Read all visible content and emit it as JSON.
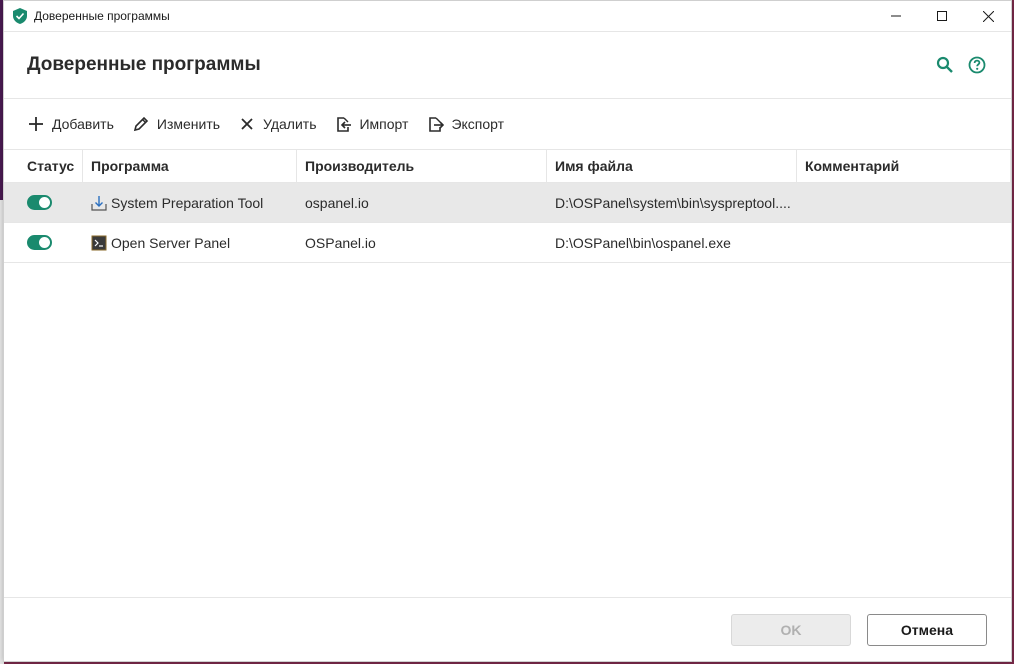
{
  "window": {
    "title": "Доверенные программы"
  },
  "header": {
    "title": "Доверенные программы",
    "icons": [
      "search-icon",
      "help-icon"
    ]
  },
  "toolbar": {
    "add_label": "Добавить",
    "edit_label": "Изменить",
    "delete_label": "Удалить",
    "import_label": "Импорт",
    "export_label": "Экспорт"
  },
  "table": {
    "columns": {
      "status": "Статус",
      "program": "Программа",
      "vendor": "Производитель",
      "file": "Имя файла",
      "comment": "Комментарий"
    },
    "rows": [
      {
        "status_on": true,
        "icon": "download-installer-icon",
        "program": "System Preparation Tool",
        "vendor": "ospanel.io",
        "file": "D:\\OSPanel\\system\\bin\\syspreptool....",
        "comment": ""
      },
      {
        "status_on": true,
        "icon": "terminal-icon",
        "program": "Open Server Panel",
        "vendor": "OSPanel.io",
        "file": "D:\\OSPanel\\bin\\ospanel.exe",
        "comment": ""
      }
    ]
  },
  "footer": {
    "ok_label": "OK",
    "cancel_label": "Отмена"
  },
  "colors": {
    "accent": "#1a8a6e",
    "selected_row": "#e8e8e8"
  }
}
